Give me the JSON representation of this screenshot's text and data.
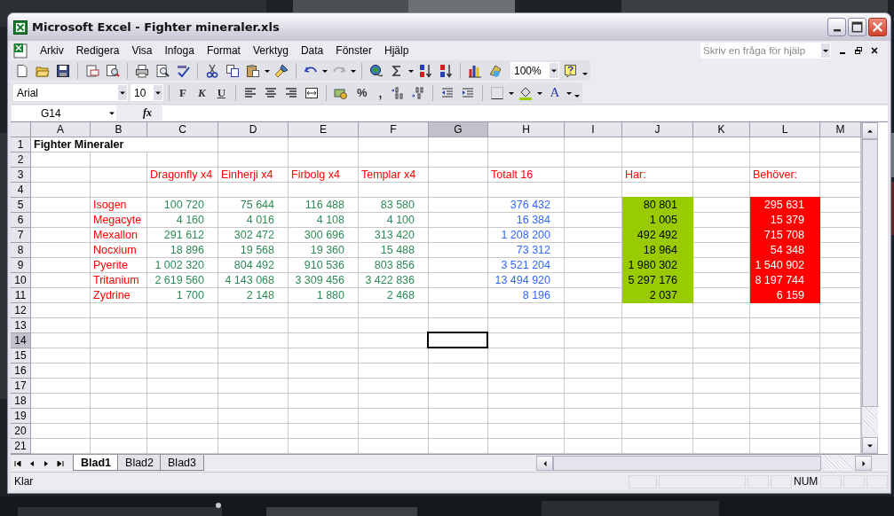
{
  "window": {
    "title": "Microsoft Excel - Fighter mineraler.xls"
  },
  "menu": [
    "Arkiv",
    "Redigera",
    "Visa",
    "Infoga",
    "Format",
    "Verktyg",
    "Data",
    "Fönster",
    "Hjälp"
  ],
  "help_search": {
    "placeholder": "Skriv en fråga för hjälp"
  },
  "toolbar": {
    "zoom": "100%"
  },
  "format_toolbar": {
    "font": "Arial",
    "size": "10",
    "bold": "F",
    "italic": "K",
    "underline": "U",
    "percent": "%",
    "comma": ",",
    "font_color": "A"
  },
  "formula_bar": {
    "name_box": "G14",
    "label": "fx"
  },
  "columns": [
    {
      "label": "A",
      "selected": false
    },
    {
      "label": "B",
      "selected": false
    },
    {
      "label": "C",
      "selected": false
    },
    {
      "label": "D",
      "selected": false
    },
    {
      "label": "E",
      "selected": false
    },
    {
      "label": "F",
      "selected": false
    },
    {
      "label": "G",
      "selected": true
    },
    {
      "label": "H",
      "selected": false
    },
    {
      "label": "I",
      "selected": false
    },
    {
      "label": "J",
      "selected": false
    },
    {
      "label": "K",
      "selected": false
    },
    {
      "label": "L",
      "selected": false
    },
    {
      "label": "M",
      "selected": false
    }
  ],
  "rows": [
    {
      "number": "1",
      "selected": false
    },
    {
      "number": "2",
      "selected": false
    },
    {
      "number": "3",
      "selected": false
    },
    {
      "number": "4",
      "selected": false
    },
    {
      "number": "5",
      "selected": false
    },
    {
      "number": "6",
      "selected": false
    },
    {
      "number": "7",
      "selected": false
    },
    {
      "number": "8",
      "selected": false
    },
    {
      "number": "9",
      "selected": false
    },
    {
      "number": "10",
      "selected": false
    },
    {
      "number": "11",
      "selected": false
    },
    {
      "number": "12",
      "selected": false
    },
    {
      "number": "13",
      "selected": false
    },
    {
      "number": "14",
      "selected": true
    },
    {
      "number": "15",
      "selected": false
    },
    {
      "number": "16",
      "selected": false
    },
    {
      "number": "17",
      "selected": false
    },
    {
      "number": "18",
      "selected": false
    },
    {
      "number": "19",
      "selected": false
    },
    {
      "number": "20",
      "selected": false
    },
    {
      "number": "21",
      "selected": false
    }
  ],
  "sheet": {
    "title": "Fighter Mineraler",
    "headings": {
      "ships": [
        "Dragonfly x4",
        "Einherji x4",
        "Firbolg x4",
        "Templar x4"
      ],
      "total": "Totalt 16",
      "have": "Har:",
      "need": "Behöver:"
    },
    "minerals": [
      {
        "name": "Isogen",
        "ships": [
          "100 720",
          "75 644",
          "116 488",
          "83 580"
        ],
        "total": "376 432",
        "have": "80 801",
        "need": "295 631"
      },
      {
        "name": "Megacyte",
        "ships": [
          "4 160",
          "4 016",
          "4 108",
          "4 100"
        ],
        "total": "16 384",
        "have": "1 005",
        "need": "15 379"
      },
      {
        "name": "Mexallon",
        "ships": [
          "291 612",
          "302 472",
          "300 696",
          "313 420"
        ],
        "total": "1 208 200",
        "have": "492 492",
        "need": "715 708"
      },
      {
        "name": "Nocxium",
        "ships": [
          "18 896",
          "19 568",
          "19 360",
          "15 488"
        ],
        "total": "73 312",
        "have": "18 964",
        "need": "54 348"
      },
      {
        "name": "Pyerite",
        "ships": [
          "1 002 320",
          "804 492",
          "910 536",
          "803 856"
        ],
        "total": "3 521 204",
        "have": "1 980 302",
        "need": "1 540 902"
      },
      {
        "name": "Tritanium",
        "ships": [
          "2 619 560",
          "4 143 068",
          "3 309 456",
          "3 422 836"
        ],
        "total": "13 494 920",
        "have": "5 297 176",
        "need": "8 197 744"
      },
      {
        "name": "Zydrine",
        "ships": [
          "1 700",
          "2 148",
          "1 880",
          "2 468"
        ],
        "total": "8 196",
        "have": "2 037",
        "need": "6 159"
      }
    ]
  },
  "sheet_tabs": [
    {
      "label": "Blad1",
      "selected": true
    },
    {
      "label": "Blad2",
      "selected": false
    },
    {
      "label": "Blad3",
      "selected": false
    }
  ],
  "status_bar": {
    "text": "Klar",
    "num": "NUM"
  }
}
